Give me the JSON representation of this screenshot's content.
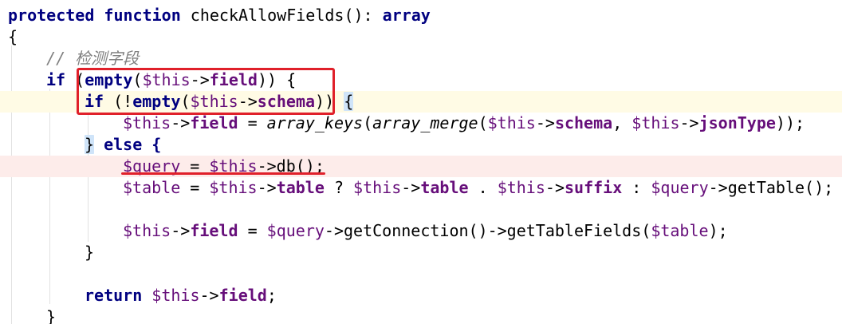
{
  "editor": {
    "lines": [
      {
        "kind": "signature",
        "kw1": "protected",
        "kw2": "function",
        "name": "checkAllowFields(): ",
        "ret": "array"
      },
      {
        "kind": "plain",
        "text": "{"
      },
      {
        "kind": "comment",
        "text": "// 检测字段"
      },
      {
        "kind": "if1",
        "kw": "if",
        "open": " (",
        "fn": "empty",
        "p1": "(",
        "var": "$this",
        "arrow": "->",
        "field": "field",
        "close": ")) {"
      },
      {
        "kind": "if2",
        "kw": "if",
        "open": " (!",
        "fn": "empty",
        "p1": "(",
        "var": "$this",
        "arrow": "->",
        "field": "schema",
        "close": "))",
        "brace": "{"
      },
      {
        "kind": "assign1",
        "var1": "$this",
        "arrow1": "->",
        "field1": "field",
        "eq": " = ",
        "fn1": "array_keys",
        "p1": "(",
        "fn2": "array_merge",
        "p2": "(",
        "var2": "$this",
        "arrow2": "->",
        "field2": "schema",
        "comma": ", ",
        "var3": "$this",
        "arrow3": "->",
        "field3": "jsonType",
        "end": "));"
      },
      {
        "kind": "else",
        "brace": "}",
        "kw": " else {"
      },
      {
        "kind": "query",
        "var1": "$query",
        "eq": " = ",
        "var2": "$this",
        "rest": "->db();"
      },
      {
        "kind": "table",
        "var1": "$table",
        "eq": " = ",
        "var2": "$this",
        "arrow2": "->",
        "f2": "table",
        "q": " ? ",
        "var3": "$this",
        "arrow3": "->",
        "f3": "table",
        "dot": " . ",
        "var4": "$this",
        "arrow4": "->",
        "f4": "suffix",
        "colon": " : ",
        "var5": "$query",
        "rest": "->getTable();"
      },
      {
        "kind": "blank"
      },
      {
        "kind": "conn",
        "var1": "$this",
        "arrow1": "->",
        "f1": "field",
        "eq": " = ",
        "var2": "$query",
        "mid": "->getConnection()->getTableFields(",
        "var3": "$table",
        "end": ");"
      },
      {
        "kind": "plain",
        "text": "}"
      },
      {
        "kind": "blank"
      },
      {
        "kind": "return",
        "kw": "return",
        "sp": " ",
        "var": "$this",
        "arrow": "->",
        "f": "field",
        "end": ";"
      },
      {
        "kind": "plain",
        "text": "}"
      }
    ]
  },
  "colors": {
    "keyword": "#000080",
    "variable": "#660e7a",
    "comment": "#808080",
    "annotation": "#e0202a",
    "caret_line": "#fffbe5",
    "error_line": "#fdecea",
    "brace_match": "#cfe4f9"
  }
}
